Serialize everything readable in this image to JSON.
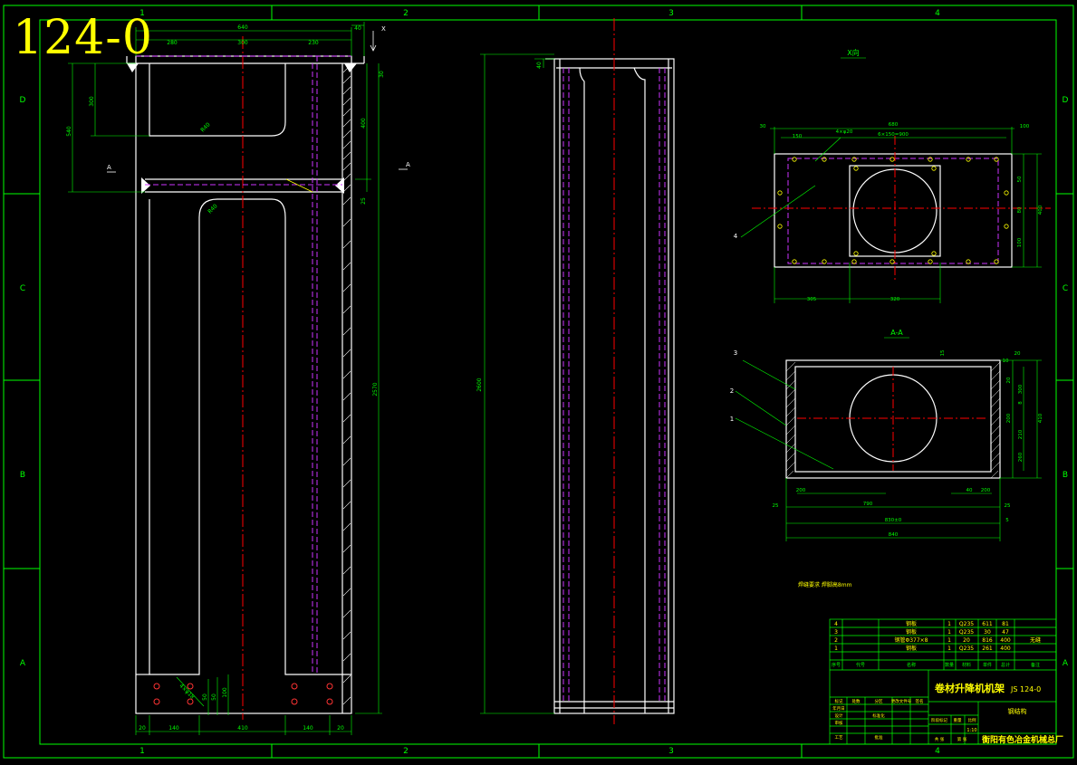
{
  "drawing": {
    "number": "124-0",
    "zone_columns": [
      "1",
      "2",
      "3",
      "4"
    ],
    "zone_rows": [
      "D",
      "C",
      "B",
      "A"
    ]
  },
  "views": {
    "x_view_label": "X向",
    "section_label": "A-A",
    "arrow_x": "X",
    "arrow_a": "A"
  },
  "dimensions": {
    "front_top": [
      "640",
      "40",
      "280",
      "300",
      "230"
    ],
    "front_left": [
      "300",
      "540"
    ],
    "front_right": [
      "30",
      "400",
      "25",
      "2570"
    ],
    "front_radius": [
      "R40",
      "R40"
    ],
    "front_bottom": [
      "20",
      "140",
      "410",
      "140",
      "20"
    ],
    "front_bottom_small": [
      "4×φ18",
      "50",
      "50",
      "100"
    ],
    "side": [
      "40",
      "2600"
    ],
    "x_view": [
      "30",
      "680",
      "6×150=900",
      "100",
      "150",
      "4×φ20",
      "305",
      "320",
      "50",
      "80",
      "100",
      "400"
    ],
    "section": [
      "15",
      "20",
      "10",
      "300",
      "8",
      "20",
      "200",
      "210",
      "260",
      "410",
      "790",
      "830±0",
      "840",
      "25",
      "5",
      "25",
      "40",
      "200",
      "200"
    ]
  },
  "callouts": [
    "4",
    "3",
    "2",
    "1"
  ],
  "note": "焊缝要求 焊脚高8mm",
  "title_block": {
    "parts_header": [
      "序号",
      "代号",
      "名称",
      "数量",
      "材料",
      "单件",
      "总计",
      "备注"
    ],
    "parts_rows": [
      [
        "4",
        "",
        "钢板",
        "1",
        "Q235",
        "611",
        "81",
        ""
      ],
      [
        "3",
        "",
        "钢板",
        "1",
        "Q235",
        "30",
        "47",
        ""
      ],
      [
        "2",
        "",
        "钢管Φ377×8",
        "1",
        "20",
        "816",
        "400",
        "无缝"
      ],
      [
        "1",
        "",
        "钢板",
        "1",
        "Q235",
        "261",
        "400",
        ""
      ]
    ],
    "drawing_name": "卷材升降机机架",
    "drawing_code": "JS 124-0",
    "part_title": "钢结构",
    "company": "衡阳有色冶金机械总厂",
    "sign_labels": [
      "标记",
      "处数",
      "分区",
      "更改文件号",
      "签名",
      "年月日",
      "设计",
      "标准化",
      "审核",
      "工艺",
      "批准"
    ],
    "meta_labels": [
      "阶段标记",
      "重量",
      "比例",
      "共 张",
      "第 张"
    ],
    "scale": "1:10"
  }
}
